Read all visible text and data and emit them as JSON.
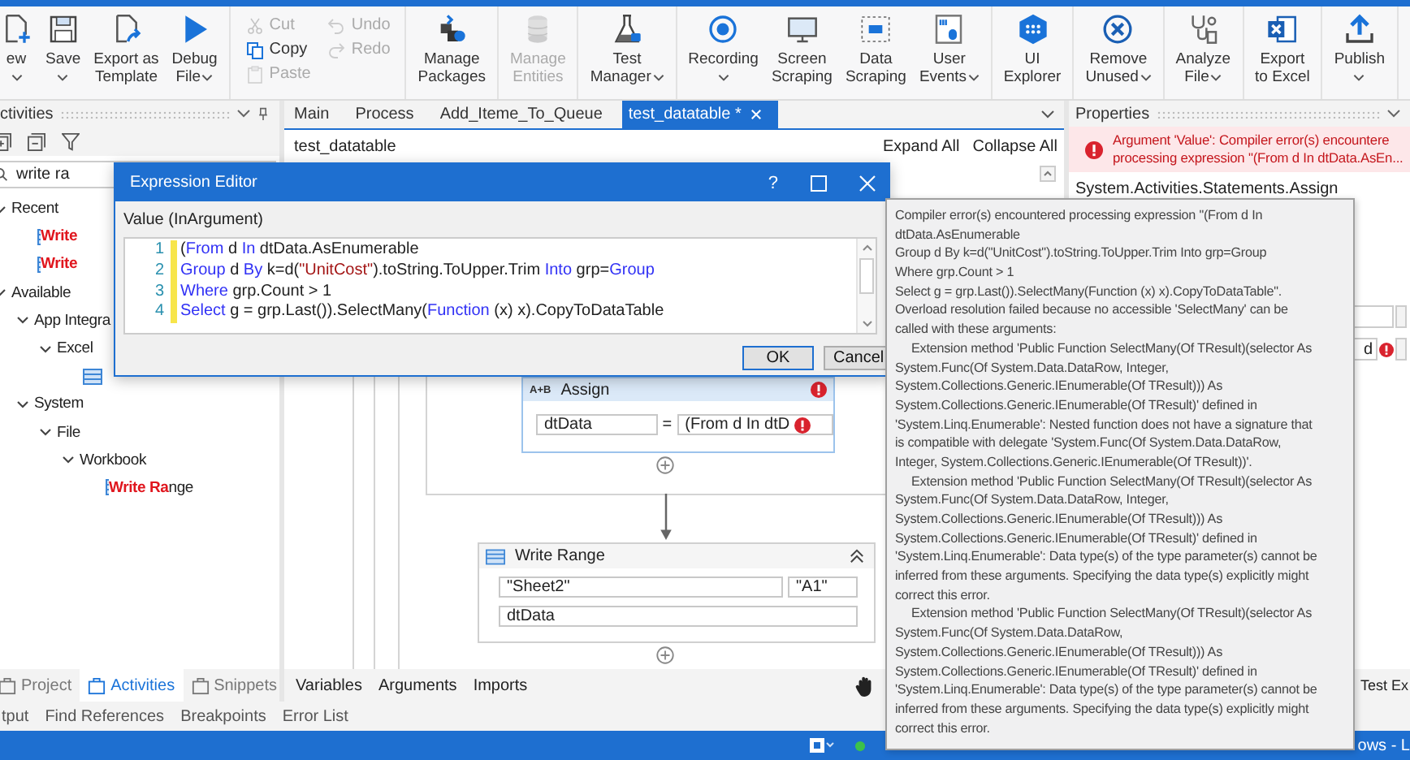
{
  "ribbon": {
    "groups": [
      {
        "kind": "large",
        "items": [
          {
            "label": [
              "ew"
            ],
            "dropdown": true,
            "disabled": false
          },
          {
            "label": [
              "Save"
            ],
            "dropdown": true,
            "disabled": false
          },
          {
            "label": [
              "Export as",
              "Template"
            ],
            "dropdown": false,
            "disabled": false
          },
          {
            "label": [
              "Debug",
              "File"
            ],
            "dropdown": true,
            "disabled": false
          }
        ]
      },
      {
        "kind": "small",
        "items": [
          {
            "label": "Cut",
            "disabled": true
          },
          {
            "label": "Copy",
            "disabled": false
          },
          {
            "label": "Paste",
            "disabled": true
          },
          {
            "label": "Undo",
            "disabled": true
          },
          {
            "label": "Redo",
            "disabled": true
          }
        ]
      },
      {
        "kind": "large",
        "items": [
          {
            "label": [
              "Manage",
              "Packages"
            ],
            "dropdown": false,
            "disabled": false
          }
        ]
      },
      {
        "kind": "large",
        "items": [
          {
            "label": [
              "Manage",
              "Entities"
            ],
            "dropdown": false,
            "disabled": true
          }
        ]
      },
      {
        "kind": "large",
        "items": [
          {
            "label": [
              "Test",
              "Manager"
            ],
            "dropdown": true,
            "disabled": false
          }
        ]
      },
      {
        "kind": "large",
        "items": [
          {
            "label": [
              "Recording"
            ],
            "dropdown": true,
            "disabled": false
          },
          {
            "label": [
              "Screen",
              "Scraping"
            ],
            "dropdown": false,
            "disabled": false
          },
          {
            "label": [
              "Data",
              "Scraping"
            ],
            "dropdown": false,
            "disabled": false
          },
          {
            "label": [
              "User",
              "Events"
            ],
            "dropdown": true,
            "disabled": false
          }
        ]
      },
      {
        "kind": "large",
        "items": [
          {
            "label": [
              "UI",
              "Explorer"
            ],
            "dropdown": false,
            "disabled": false
          }
        ]
      },
      {
        "kind": "large",
        "items": [
          {
            "label": [
              "Remove",
              "Unused"
            ],
            "dropdown": true,
            "disabled": false
          }
        ]
      },
      {
        "kind": "large",
        "items": [
          {
            "label": [
              "Analyze",
              "File"
            ],
            "dropdown": true,
            "disabled": false
          }
        ]
      },
      {
        "kind": "large",
        "items": [
          {
            "label": [
              "Export",
              "to Excel"
            ],
            "dropdown": false,
            "disabled": false
          }
        ]
      },
      {
        "kind": "large",
        "items": [
          {
            "label": [
              "Publish"
            ],
            "dropdown": true,
            "disabled": false
          }
        ]
      }
    ]
  },
  "activities_panel": {
    "title": "ctivities",
    "search": {
      "value": "write ra"
    },
    "tree": [
      {
        "kind": "category",
        "label": "Recent",
        "expanded": true,
        "children": [
          {
            "kind": "activity",
            "label": "Write",
            "match": true
          },
          {
            "kind": "activity",
            "label": "Write",
            "match": true
          }
        ]
      },
      {
        "kind": "category",
        "label": "Available",
        "expanded": true,
        "children": [
          {
            "kind": "category",
            "label": "App Integra",
            "expanded": true,
            "children": [
              {
                "kind": "category",
                "label": "Excel",
                "expanded": true,
                "children": [
                  {
                    "kind": "activity"
                  }
                ]
              }
            ]
          },
          {
            "kind": "category",
            "label": "System",
            "expanded": true,
            "children": [
              {
                "kind": "category",
                "label": "File",
                "expanded": true,
                "children": [
                  {
                    "kind": "category",
                    "label": "Workbook",
                    "expanded": true,
                    "children": [
                      {
                        "kind": "activity",
                        "label": "**Write Ra**nge",
                        "match": false
                      }
                    ]
                  }
                ]
              }
            ]
          }
        ]
      }
    ],
    "tabs": [
      {
        "label": "Project",
        "selected": false
      },
      {
        "label": "Activities",
        "selected": true
      },
      {
        "label": "Snippets",
        "selected": false
      }
    ]
  },
  "designer": {
    "tabs": [
      {
        "label": "Main",
        "selected": false,
        "closable": false
      },
      {
        "label": "Process",
        "selected": false,
        "closable": false
      },
      {
        "label": "Add_Iteme_To_Queue",
        "selected": false,
        "closable": false
      },
      {
        "label": "test_datatable *",
        "selected": true,
        "closable": true
      }
    ],
    "breadcrumb": "test_datatable",
    "expand_all": "Expand All",
    "collapse_all": "Collapse All",
    "activities": [
      {
        "kind": "assign",
        "icon_text": "A+B",
        "title": "Assign",
        "error": true,
        "to": "dtData",
        "equals": "=",
        "value": "(From d In dtD",
        "value_error": true
      },
      {
        "kind": "write_range",
        "title": "Write Range",
        "sheet": "\"Sheet2\"",
        "cell": "\"A1\"",
        "datatable": "dtData"
      }
    ],
    "bottom_tabs": [
      "Variables",
      "Arguments",
      "Imports"
    ]
  },
  "properties": {
    "title": "Properties",
    "error_lines": [
      "Argument 'Value': Compiler error(s) encountere",
      "processing expression \"(From d In dtData.AsEn..."
    ],
    "activity_type": "System.Activities.Statements.Assign",
    "field_value": "d",
    "field_error": true,
    "bottom_tab": "Test Ex"
  },
  "output_tabs": [
    "tput",
    "Find References",
    "Breakpoints",
    "Error List"
  ],
  "status_bar": {
    "right_text": "ows - L"
  },
  "expression_editor": {
    "title": "Expression Editor",
    "help": "?",
    "label": "Value (InArgument)",
    "lines": [
      {
        "number": "1",
        "tokens": [
          {
            "kind": "plain",
            "text": "("
          },
          {
            "kind": "keyword",
            "text": "From"
          },
          {
            "kind": "plain",
            "text": " d "
          },
          {
            "kind": "keyword",
            "text": "In"
          },
          {
            "kind": "plain",
            "text": " dtData.AsEnumerable"
          }
        ]
      },
      {
        "number": "2",
        "tokens": [
          {
            "kind": "keyword",
            "text": "Group"
          },
          {
            "kind": "plain",
            "text": " d "
          },
          {
            "kind": "keyword",
            "text": "By"
          },
          {
            "kind": "plain",
            "text": " k=d("
          },
          {
            "kind": "string",
            "text": "\"UnitCost\""
          },
          {
            "kind": "plain",
            "text": ").toString.ToUpper.Trim "
          },
          {
            "kind": "keyword",
            "text": "Into"
          },
          {
            "kind": "plain",
            "text": " grp="
          },
          {
            "kind": "keyword",
            "text": "Group"
          }
        ]
      },
      {
        "number": "3",
        "tokens": [
          {
            "kind": "keyword",
            "text": "Where"
          },
          {
            "kind": "plain",
            "text": " grp.Count > 1"
          }
        ]
      },
      {
        "number": "4",
        "tokens": [
          {
            "kind": "keyword",
            "text": "Select"
          },
          {
            "kind": "plain",
            "text": " g = grp.Last()).SelectMany("
          },
          {
            "kind": "keyword",
            "text": "Function"
          },
          {
            "kind": "plain",
            "text": " (x) x).CopyToDataTable"
          }
        ]
      }
    ],
    "buttons": [
      {
        "label": "OK",
        "default": true
      },
      {
        "label": "Cancel",
        "default": false
      }
    ]
  },
  "tooltip": {
    "lines": [
      {
        "text": "Compiler error(s) encountered processing expression \"(From d In",
        "indent": false
      },
      {
        "text": "dtData.AsEnumerable",
        "indent": false
      },
      {
        "text": "Group d By k=d(\"UnitCost\").toString.ToUpper.Trim Into grp=Group",
        "indent": false
      },
      {
        "text": "Where grp.Count > 1",
        "indent": false
      },
      {
        "text": "Select g = grp.Last()).SelectMany(Function (x) x).CopyToDataTable\".",
        "indent": false
      },
      {
        "text": "Overload resolution failed because no accessible 'SelectMany' can be",
        "indent": false
      },
      {
        "text": "called with these arguments:",
        "indent": false
      },
      {
        "text": "Extension method 'Public Function SelectMany(Of TResult)(selector As",
        "indent": true
      },
      {
        "text": "System.Func(Of System.Data.DataRow, Integer,",
        "indent": false
      },
      {
        "text": "System.Collections.Generic.IEnumerable(Of TResult))) As",
        "indent": false
      },
      {
        "text": "System.Collections.Generic.IEnumerable(Of TResult)' defined in",
        "indent": false
      },
      {
        "text": "'System.Linq.Enumerable': Nested function does not have a signature that",
        "indent": false
      },
      {
        "text": "is compatible with delegate 'System.Func(Of System.Data.DataRow,",
        "indent": false
      },
      {
        "text": "Integer, System.Collections.Generic.IEnumerable(Of TResult))'.",
        "indent": false
      },
      {
        "text": "Extension method 'Public Function SelectMany(Of TResult)(selector As",
        "indent": true
      },
      {
        "text": "System.Func(Of System.Data.DataRow, Integer,",
        "indent": false
      },
      {
        "text": "System.Collections.Generic.IEnumerable(Of TResult))) As",
        "indent": false
      },
      {
        "text": "System.Collections.Generic.IEnumerable(Of TResult)' defined in",
        "indent": false
      },
      {
        "text": "'System.Linq.Enumerable': Data type(s) of the type parameter(s) cannot be",
        "indent": false
      },
      {
        "text": "inferred from these arguments. Specifying the data type(s) explicitly might",
        "indent": false
      },
      {
        "text": "correct this error.",
        "indent": false
      },
      {
        "text": "Extension method 'Public Function SelectMany(Of TResult)(selector As",
        "indent": true
      },
      {
        "text": "System.Func(Of System.Data.DataRow,",
        "indent": false
      },
      {
        "text": "System.Collections.Generic.IEnumerable(Of TResult))) As",
        "indent": false
      },
      {
        "text": "System.Collections.Generic.IEnumerable(Of TResult)' defined in",
        "indent": false
      },
      {
        "text": "'System.Linq.Enumerable': Data type(s) of the type parameter(s) cannot be",
        "indent": false
      },
      {
        "text": "inferred from these arguments. Specifying the data type(s) explicitly might",
        "indent": false
      },
      {
        "text": "correct this error.",
        "indent": false
      }
    ]
  }
}
